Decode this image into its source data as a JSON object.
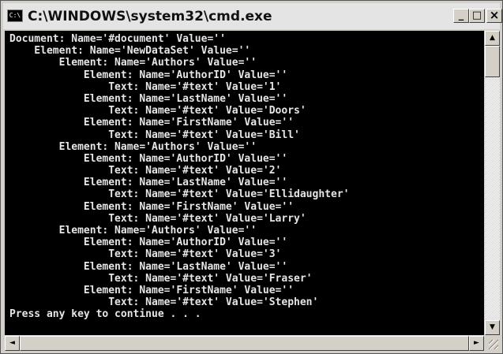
{
  "window": {
    "title": "C:\\WINDOWS\\system32\\cmd.exe",
    "icon_label": "C:\\",
    "icon": "cmd-console-icon",
    "buttons": {
      "minimize": "_",
      "maximize": "□",
      "close": "×"
    }
  },
  "console": {
    "lines": [
      "Document: Name='#document' Value=''",
      "    Element: Name='NewDataSet' Value=''",
      "        Element: Name='Authors' Value=''",
      "            Element: Name='AuthorID' Value=''",
      "                Text: Name='#text' Value='1'",
      "            Element: Name='LastName' Value=''",
      "                Text: Name='#text' Value='Doors'",
      "            Element: Name='FirstName' Value=''",
      "                Text: Name='#text' Value='Bill'",
      "        Element: Name='Authors' Value=''",
      "            Element: Name='AuthorID' Value=''",
      "                Text: Name='#text' Value='2'",
      "            Element: Name='LastName' Value=''",
      "                Text: Name='#text' Value='Ellidaughter'",
      "            Element: Name='FirstName' Value=''",
      "                Text: Name='#text' Value='Larry'",
      "        Element: Name='Authors' Value=''",
      "            Element: Name='AuthorID' Value=''",
      "                Text: Name='#text' Value='3'",
      "            Element: Name='LastName' Value=''",
      "                Text: Name='#text' Value='Fraser'",
      "            Element: Name='FirstName' Value=''",
      "                Text: Name='#text' Value='Stephen'",
      "Press any key to continue . . ."
    ]
  },
  "scrollbars": {
    "up_arrow": "▲",
    "down_arrow": "▼",
    "left_arrow": "◄",
    "right_arrow": "►"
  },
  "colors": {
    "console_background": "#000000",
    "console_text": "#e6e6e6",
    "titlebar": "#e4e4e4",
    "chrome": "#d4d0c8"
  }
}
